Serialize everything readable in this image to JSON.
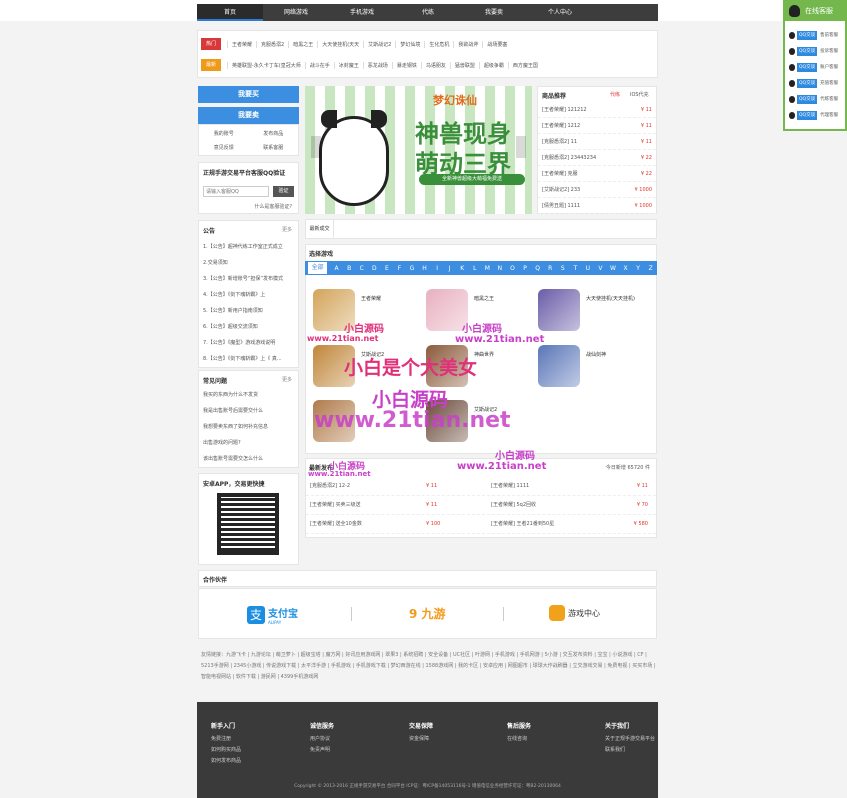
{
  "nav": [
    "首页",
    "网络游戏",
    "手机游戏",
    "代练",
    "我要卖",
    "个人中心"
  ],
  "hot": {
    "tag1": "热门",
    "tag2": "最新",
    "row1": [
      "王者荣耀",
      "克服悉溺2",
      "暗黑之王",
      "大天使挂机(天天",
      "艾斯战记2",
      "梦幻仙境",
      "生化危机",
      "我欲战斧",
      "战场要塞"
    ],
    "row2": [
      "英雄联盟-永久卡丁车(皇冠大师",
      "战斗在手",
      "冰封魔王",
      "恶龙战场",
      "暴走钢铁",
      "乌语朋友",
      "猛兽联盟",
      "超级争霸",
      "西方魔王国"
    ]
  },
  "btn_sell": "我要买",
  "btn_sell2": "我要卖",
  "small_links": [
    "我的账号",
    "发布商品",
    "意见反馈",
    "联系客服"
  ],
  "verify": {
    "title": "正规手游交易平台客服QQ验证",
    "placeholder": "请输入客服QQ",
    "btn": "验证",
    "hint": "什么是客服验证?"
  },
  "notice": {
    "title": "公告",
    "more": "更多",
    "items": [
      "1.【公告】超神代练工作室正式成立",
      "2.交易须知",
      "3.【公告】新增账号“担保”发布模式",
      "4.【公告】《剑下魂斩霸》上",
      "5.【公告】新用户指南须知",
      "6.【公告】超级交流须知",
      "7.【公告】《魔型》游戏游戏说明",
      "8.【公告】《剑下魂斩霸》上《 真..."
    ]
  },
  "faq": {
    "title": "常见问题",
    "more": "更多",
    "items": [
      "我买的东西为什么不发货",
      "我是出售账号后需要交什么",
      "我想要卖东西了如何补充信息",
      "出售游戏的问题?",
      "该出售账号需要交怎么什么"
    ]
  },
  "app": {
    "title": "安卓APP，交易更快捷"
  },
  "banner": {
    "logo": "梦幻诛仙",
    "line1": "神兽现身",
    "line2": "萌动三界",
    "sub": "全新神兽超级大萌福免费送"
  },
  "rec": {
    "title": "商品推荐",
    "tab1": "代练",
    "tab2": "IOS代充",
    "rows": [
      [
        "[王者荣耀] 121212",
        "¥ 11"
      ],
      [
        "[王者荣耀] 1212",
        "¥ 11"
      ],
      [
        "[克服悉溺2] 11",
        "¥ 11"
      ],
      [
        "[克服悉溺2] 23443234",
        "¥ 22"
      ],
      [
        "[王者荣耀] 克服",
        "¥ 22"
      ],
      [
        "[艾斯战记2] 233",
        "¥ 1000"
      ],
      [
        "[倩男丑题] 1111",
        "¥ 1000"
      ]
    ]
  },
  "tab": "最新成交",
  "choose": {
    "title": "选择游戏",
    "letters": [
      "全部",
      "A",
      "B",
      "C",
      "D",
      "E",
      "F",
      "G",
      "H",
      "I",
      "J",
      "K",
      "L",
      "M",
      "N",
      "O",
      "P",
      "Q",
      "R",
      "S",
      "T",
      "U",
      "V",
      "W",
      "X",
      "Y",
      "Z"
    ]
  },
  "games": [
    {
      "name": "王者荣耀",
      "c": "#d3a45a"
    },
    {
      "name": "暗黑之王",
      "c": "#e8b0c0"
    },
    {
      "name": "大天使挂机(天天挂机)",
      "c": "#6a5ca8"
    },
    {
      "name": "艾斯战记2",
      "c": "#c0863a"
    },
    {
      "name": "神曲世界",
      "c": "#8a5a3a"
    },
    {
      "name": "战仙剑神",
      "c": "#5a76b8"
    },
    {
      "name": "",
      "c": "#b07a4a"
    },
    {
      "name": "艾斯战记2",
      "c": "#6b4a3a"
    }
  ],
  "latest": {
    "title": "最新发布",
    "count": "今日新增 65720 件",
    "rows": [
      [
        "[克服悉溺2] 12-2",
        "¥ 11",
        "[王者荣耀] 1111",
        "¥ 11"
      ],
      [
        "[王者荣耀] 买卖三级送",
        "¥ 11",
        "[王者荣耀] 5q2回收",
        "¥ 70"
      ],
      [
        "[王者荣耀] 送全10金数",
        "¥ 100",
        "[王者荣耀] 王者21番到50星",
        "¥ 580"
      ]
    ]
  },
  "partners": {
    "title": "合作伙伴",
    "p1": "支付宝",
    "p1sub": "ALIPAY",
    "p2": "9 九游",
    "p3": "游戏中心"
  },
  "friend": {
    "label": "友情链接：",
    "text": "九游飞卡 | 九游论坛 | 萌卫萝卜 | 超级宝塔 | 魔方网 | 好讯应用游戏网 | 翠果3 | 系统招聘 | 安全设备 | UC社区 | 叶游网 | 手机游戏 | 手机网游 | 5小游 | 交互发布资料 | 宝宝 | 小说游戏 | CF | 5213手游网 | 2345小游戏 | 传说游戏下载 | 太平洋手游 | 手机游戏 | 手机游戏下载 | 梦幻西游在线 | 1588游戏网 | 我的卡区 | 安卓应用 | 网图超市 | 球球大作战刷器 | 立交游戏交易 | 免费电视 | 买买市场 | 智能电视网站 | 软件下载 | 游民网 | 4399手机游戏网"
  },
  "footer": {
    "cols": [
      {
        "h": "新手入门",
        "i": [
          "免费注册",
          "如何购买商品",
          "如何发布商品"
        ]
      },
      {
        "h": "诚信服务",
        "i": [
          "用户协议",
          "免责声明"
        ]
      },
      {
        "h": "交易保障",
        "i": [
          "资金保障"
        ]
      },
      {
        "h": "售后服务",
        "i": [
          "在线咨询"
        ]
      },
      {
        "h": "关于我们",
        "i": [
          "关于正规手游交易平台",
          "联系我们"
        ]
      }
    ],
    "copy": "Copyright © 2013-2016 正规手游交易平台  合同平台  ICP证：粤ICP备14053116号-1  增值电信业务经营许可证：粤B2-20130064"
  },
  "qq": {
    "title": "在线客服",
    "btn": "QQ交谈",
    "rows": [
      "售前客服",
      "投诉客服",
      "账户客服",
      "充值客服",
      "代练客服",
      "代理客服"
    ]
  },
  "wm": {
    "a": "小白源码",
    "b": "www.21tian.net",
    "c": "小白是个大美女",
    "d": "小白源码",
    "e": "www.21tian.net"
  }
}
